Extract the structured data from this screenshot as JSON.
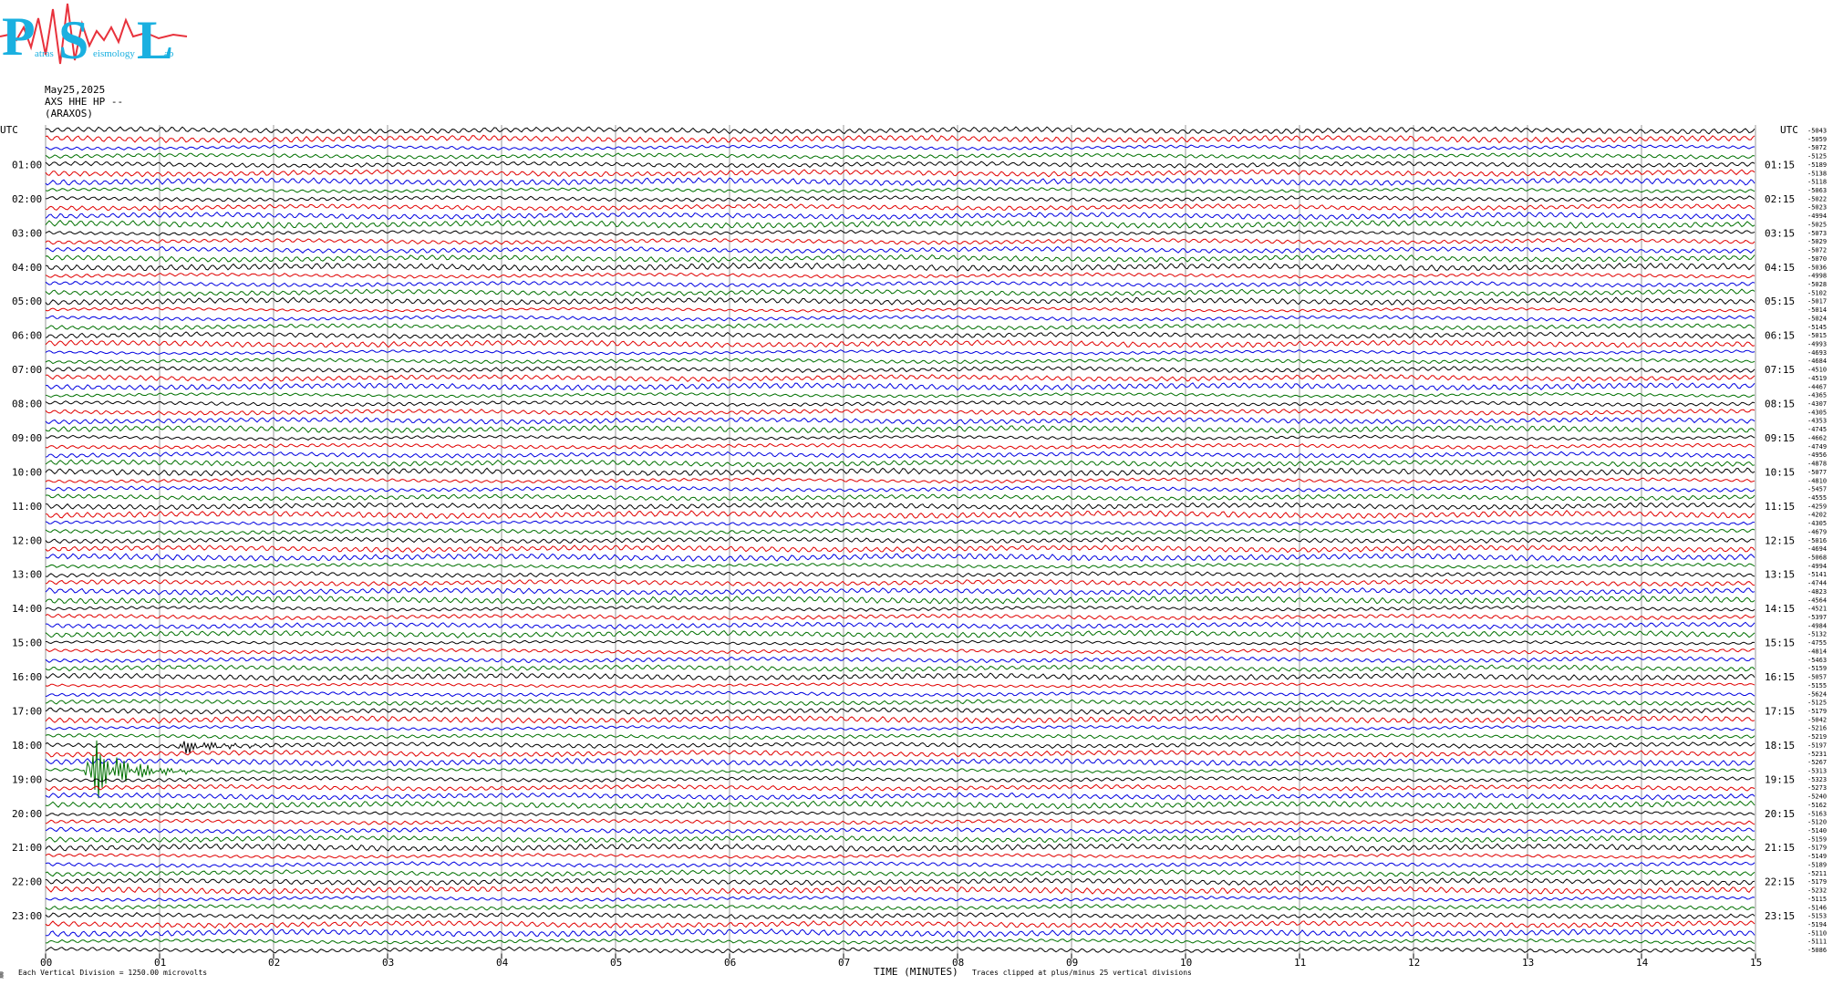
{
  "logo": {
    "letters": [
      "P",
      "S",
      "L"
    ],
    "lettering": [
      "atras",
      "eismology",
      "ab"
    ],
    "colors": {
      "text": "#1ab0e0",
      "wave": "#e8323c"
    }
  },
  "header": {
    "date": "May25,2025",
    "station": "AXS HHE HP --",
    "location": "(ARAXOS)"
  },
  "utc_label": "UTC",
  "footer": {
    "scale_note": "Each Vertical Division = 1250.00 microvolts",
    "clip_note": "Traces clipped at plus/minus 25 vertical divisions",
    "corner_mark": "▒"
  },
  "chart_data": {
    "type": "line",
    "title": "",
    "xlabel": "TIME (MINUTES)",
    "ylabel": "",
    "xlim": [
      0,
      15
    ],
    "x_ticks": [
      "00",
      "01",
      "02",
      "03",
      "04",
      "05",
      "06",
      "07",
      "08",
      "09",
      "10",
      "11",
      "12",
      "13",
      "14",
      "15"
    ],
    "grid": true,
    "trace_colors": [
      "#000000",
      "#e00000",
      "#0000e0",
      "#007000"
    ],
    "left_time_labels": [
      "01:00",
      "02:00",
      "03:00",
      "04:00",
      "05:00",
      "06:00",
      "07:00",
      "08:00",
      "09:00",
      "10:00",
      "11:00",
      "12:00",
      "13:00",
      "14:00",
      "15:00",
      "16:00",
      "17:00",
      "18:00",
      "19:00",
      "20:00",
      "21:00",
      "22:00",
      "23:00"
    ],
    "right_time_labels": [
      "01:15",
      "02:15",
      "03:15",
      "04:15",
      "05:15",
      "06:15",
      "07:15",
      "08:15",
      "09:15",
      "10:15",
      "11:15",
      "12:15",
      "13:15",
      "14:15",
      "15:15",
      "16:15",
      "17:15",
      "18:15",
      "19:15",
      "20:15",
      "21:15",
      "22:15",
      "23:15"
    ],
    "trace_offsets": [
      "-5043",
      "-5059",
      "-5072",
      "-5125",
      "-5189",
      "-5138",
      "-5118",
      "-5063",
      "-5022",
      "-5023",
      "-4994",
      "-5025",
      "-5073",
      "-5029",
      "-5072",
      "-5070",
      "-5036",
      "-4998",
      "-5028",
      "-5102",
      "-5017",
      "-5014",
      "-5024",
      "-5145",
      "-5015",
      "-4993",
      "-4693",
      "-4684",
      "-4510",
      "-4519",
      "-4467",
      "-4365",
      "-4307",
      "-4305",
      "-4353",
      "-4745",
      "-4662",
      "-4749",
      "-4956",
      "-4878",
      "-5077",
      "-4810",
      "-5457",
      "-4555",
      "-4259",
      "-4202",
      "-4305",
      "-4679",
      "-5016",
      "-4694",
      "-5068",
      "-4994",
      "-5141",
      "-4744",
      "-4823",
      "-4564",
      "-4521",
      "-5397",
      "-4984",
      "-5132",
      "-4755",
      "-4814",
      "-5463",
      "-5159",
      "-5057",
      "-5155",
      "-5624",
      "-5125",
      "-5179",
      "-5042",
      "-5216",
      "-5219",
      "-5197",
      "-5231",
      "-5267",
      "-5313",
      "-5323",
      "-5273",
      "-5240",
      "-5162",
      "-5163",
      "-5120",
      "-5140",
      "-5159",
      "-5179",
      "-5149",
      "-5189",
      "-5211",
      "-5179",
      "-5232",
      "-5115",
      "-5146",
      "-5153",
      "-5194",
      "-5110",
      "-5111",
      "-5086"
    ],
    "events": [
      {
        "hour": 18,
        "row": 3,
        "minute": 0.45,
        "label": "large earthquake"
      },
      {
        "hour": 18,
        "row": 0,
        "minute": 1.25,
        "label": "small event"
      }
    ]
  }
}
